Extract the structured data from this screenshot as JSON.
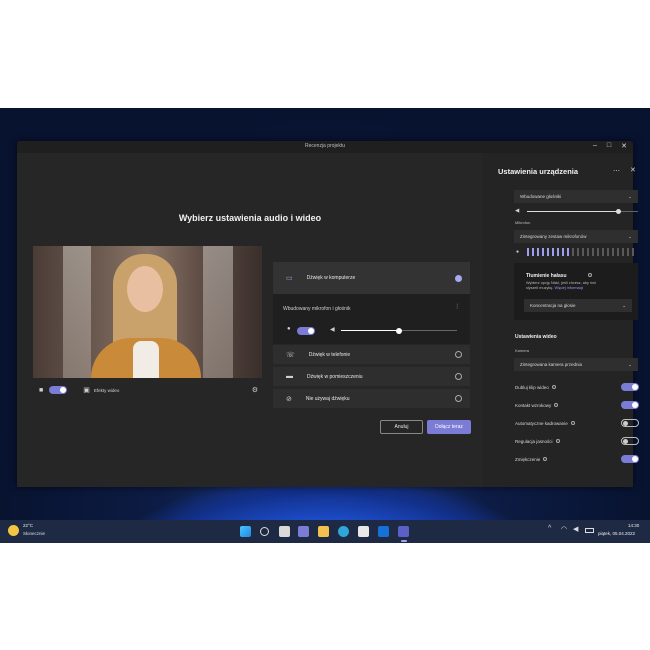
{
  "window": {
    "title": "Recenzja projektu",
    "controls": [
      "–",
      "□",
      "✕"
    ]
  },
  "main": {
    "heading": "Wybierz ustawienia audio i wideo",
    "video_controls": {
      "camera_toggle": "on",
      "effects_label": "Efekty wideo"
    },
    "audio_options": [
      {
        "label": "Dźwięk w komputerze",
        "selected": true
      },
      {
        "label": "Dźwięk w telefonie",
        "selected": false
      },
      {
        "label": "Dźwięk w pomieszczeniu",
        "selected": false
      },
      {
        "label": "Nie używaj dźwięku",
        "selected": false
      }
    ],
    "audio_sub": {
      "device_label": "Wbudowany mikrofon i głośnik",
      "mic_toggle": "on",
      "volume": 0.5
    },
    "buttons": {
      "cancel": "Anuluj",
      "join": "Dołącz teraz"
    }
  },
  "sidebar": {
    "title": "Ustawienia urządzenia",
    "speaker_device": "Wbudowane głośniki",
    "speaker_volume": 0.82,
    "mic_label": "Mikrofon",
    "mic_device": "Zintegrowany zestaw mikrofonów",
    "mic_level": 0.4,
    "noise": {
      "title": "Tłumienie hałasu",
      "desc": "Wybierz opcję Niski, jeśli chcesz, aby inni",
      "desc2": "słyszeli muzykę.",
      "link": "Więcej informacji",
      "value": "Koncentracja na głosie"
    },
    "video_title": "Ustawienia wideo",
    "camera_label": "Kamera",
    "camera_device": "Zintegrowana kamera przednia",
    "toggles": [
      {
        "label": "Dubluj klip wideo",
        "on": true
      },
      {
        "label": "Kontakt wzrokowy",
        "on": true
      },
      {
        "label": "Automatyczne kadrowanie",
        "on": false
      },
      {
        "label": "Regulacja jasności",
        "on": false
      },
      {
        "label": "Zmiękczenie",
        "on": true
      }
    ]
  },
  "taskbar": {
    "weather_temp": "22°C",
    "weather_desc": "Słonecznie",
    "time": "14:30",
    "date": "piątek, 05.04.2022"
  },
  "colors": {
    "accent": "#7b7cd6",
    "panel": "#262626",
    "sidebar": "#242424"
  }
}
